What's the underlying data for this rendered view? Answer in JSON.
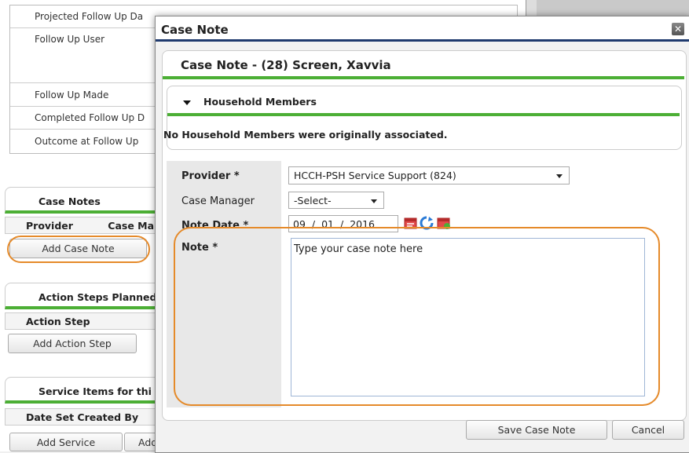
{
  "background": {
    "followup_rows": [
      "Projected Follow Up Da",
      "Follow Up User",
      "Follow Up Made",
      "Completed Follow Up D",
      "Outcome at Follow Up"
    ],
    "case_notes": {
      "title": "Case Notes",
      "col1": "Provider",
      "col2": "Case Ma",
      "button": "Add Case Note"
    },
    "action_steps": {
      "title": "Action Steps Planned",
      "col1": "Action Step",
      "button": "Add Action Step"
    },
    "service_items": {
      "title": "Service Items for thi",
      "col1": "Date Set Created By",
      "button1": "Add Service",
      "button2": "Add"
    }
  },
  "modal": {
    "title": "Case Note",
    "close": "✕",
    "heading": "Case Note - (28) Screen, Xavvia",
    "household": {
      "title": "Household Members",
      "message": "No Household Members were originally associated."
    },
    "form": {
      "provider_label": "Provider *",
      "provider_value": "HCCH-PSH Service Support (824)",
      "case_manager_label": "Case Manager",
      "case_manager_value": "-Select-",
      "note_date_label": "Note Date *",
      "date_month": "09",
      "date_day": "01",
      "date_year": "2016",
      "date_sep": "/",
      "note_label": "Note *",
      "note_value": "Type your case note here"
    },
    "save_button": "Save Case Note",
    "cancel_button": "Cancel"
  },
  "colors": {
    "accent_green": "#4caf35",
    "title_bar_blue": "#1f3a6e",
    "highlight_orange": "#e58a2a"
  }
}
